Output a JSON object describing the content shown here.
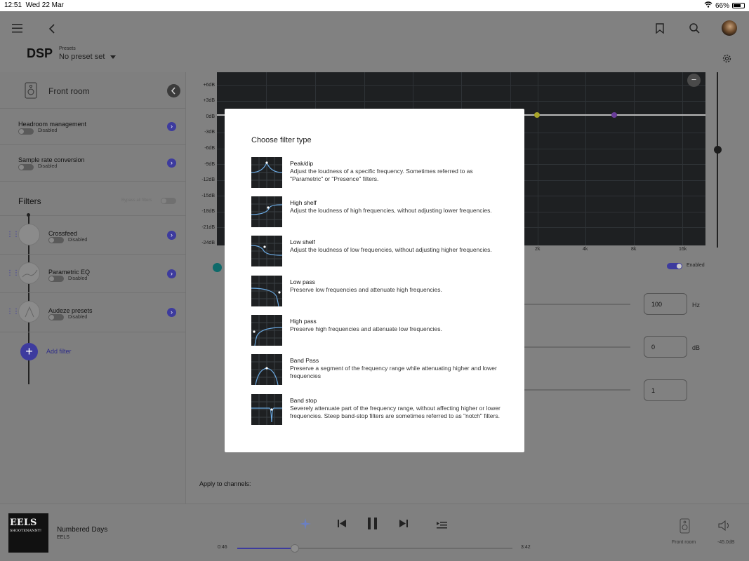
{
  "status": {
    "time": "12:51",
    "date": "Wed 22 Mar",
    "battery": "66%"
  },
  "header": {
    "title": "DSP",
    "presets_label": "Presets",
    "preset_value": "No preset set"
  },
  "sidebar": {
    "device_name": "Front room",
    "headroom": {
      "label": "Headroom management",
      "state": "Disabled"
    },
    "sample_rate": {
      "label": "Sample rate conversion",
      "state": "Disabled"
    },
    "filters_title": "Filters",
    "bypass_label": "Bypass all filters",
    "filters": [
      {
        "label": "Crossfeed",
        "state": "Disabled"
      },
      {
        "label": "Parametric EQ",
        "state": "Disabled"
      },
      {
        "label": "Audeze presets",
        "state": "Disabled"
      }
    ],
    "add_filter": "Add filter"
  },
  "graph": {
    "y_ticks": [
      "+6dB",
      "+3dB",
      "0dB",
      "-3dB",
      "-6dB",
      "-9dB",
      "-12dB",
      "-15dB",
      "-18dB",
      "-21dB",
      "-24dB"
    ],
    "x_ticks": [
      "2k",
      "4k",
      "8k",
      "16k"
    ],
    "enabled_label": "Enabled",
    "zoom_out": "−"
  },
  "params": {
    "freq": {
      "value": "100",
      "unit": "Hz"
    },
    "gain": {
      "value": "0",
      "unit": "dB"
    },
    "q": {
      "value": "1"
    }
  },
  "apply_channels": "Apply to channels:",
  "player": {
    "album_art_text": "EELS",
    "album_art_sub": "SHOOTENANNY!",
    "track": "Numbered Days",
    "artist": "EELS",
    "elapsed": "0:46",
    "duration": "3:42",
    "progress": 0.21,
    "zone": "Front room",
    "volume": "-45.0dB"
  },
  "modal": {
    "title": "Choose filter type",
    "options": [
      {
        "title": "Peak/dip",
        "desc": "Adjust the loudness of a specific frequency. Sometimes referred to as \"Parametric\" or \"Presence\" filters."
      },
      {
        "title": "High shelf",
        "desc": "Adjust the loudness of high frequencies, without adjusting lower frequencies."
      },
      {
        "title": "Low shelf",
        "desc": "Adjust the loudness of low frequencies, without adjusting higher frequencies."
      },
      {
        "title": "Low pass",
        "desc": "Preserve low frequencies and attenuate high frequencies."
      },
      {
        "title": "High pass",
        "desc": "Preserve high frequencies and attenuate low frequencies."
      },
      {
        "title": "Band Pass",
        "desc": "Preserve a segment of the frequency range while attenuating higher and lower frequencies"
      },
      {
        "title": "Band stop",
        "desc": "Severely attenuate part of the frequency range, without affecting higher or lower frequencies. Steep band-stop filters are sometimes referred to as \"notch\" filters."
      }
    ]
  },
  "colors": {
    "accent": "#3d3b9e",
    "graph_bg": "#1e2022",
    "dot_yellow": "#a9a52a",
    "dot_purple": "#6a3d9a",
    "teal": "#0e6a6a"
  }
}
